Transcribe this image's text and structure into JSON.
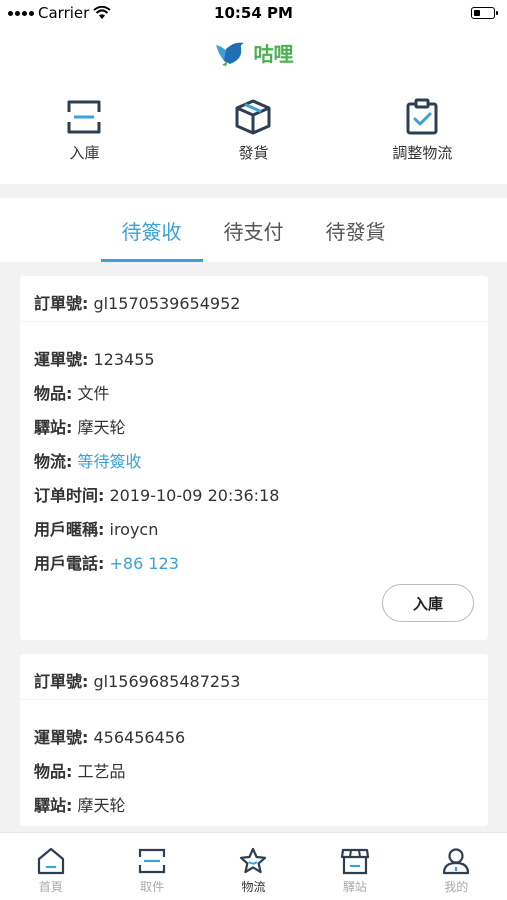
{
  "status_bar": {
    "carrier": "Carrier",
    "time": "10:54 PM"
  },
  "brand": {
    "name": "咕哩",
    "color": "#4caf50"
  },
  "quick_actions": [
    {
      "label": "入庫",
      "icon": "scan-frame-icon"
    },
    {
      "label": "發貨",
      "icon": "package-box-icon"
    },
    {
      "label": "調整物流",
      "icon": "clipboard-check-icon"
    }
  ],
  "tabs": [
    {
      "label": "待簽收",
      "active": true
    },
    {
      "label": "待支付",
      "active": false
    },
    {
      "label": "待發貨",
      "active": false
    }
  ],
  "orders": [
    {
      "order_label": "訂單號:",
      "order_no": "gl1570539654952",
      "waybill_label": "運單號:",
      "waybill": "123455",
      "item_label": "物品:",
      "item": "文件",
      "station_label": "驛站:",
      "station": "摩天轮",
      "logistics_label": "物流:",
      "logistics": "等待簽收",
      "time_label": "订单时间:",
      "time": "2019-10-09 20:36:18",
      "nickname_label": "用戶暱稱:",
      "nickname": "iroycn",
      "phone_label": "用戶電話:",
      "phone": "+86 123",
      "action": "入庫"
    },
    {
      "order_label": "訂單號:",
      "order_no": "gl1569685487253",
      "waybill_label": "運單號:",
      "waybill": "456456456",
      "item_label": "物品:",
      "item": "工艺品",
      "station_label": "驛站:",
      "station": "摩天轮"
    }
  ],
  "tabbar": [
    {
      "label": "首頁",
      "icon": "home-icon",
      "active": false
    },
    {
      "label": "取件",
      "icon": "scan-frame-icon",
      "active": false
    },
    {
      "label": "物流",
      "icon": "star-icon",
      "active": true
    },
    {
      "label": "驛站",
      "icon": "store-icon",
      "active": false
    },
    {
      "label": "我的",
      "icon": "user-icon",
      "active": false
    }
  ],
  "colors": {
    "accent": "#3aa2d8",
    "icon": "#2c3e50"
  }
}
